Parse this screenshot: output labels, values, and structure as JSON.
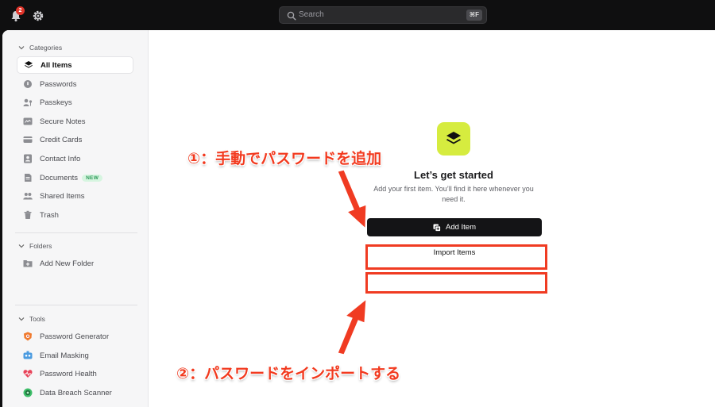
{
  "topbar": {
    "notification_count": "2",
    "search": {
      "placeholder": "Search",
      "shortcut": "⌘F"
    }
  },
  "sidebar": {
    "categories_label": "Categories",
    "categories": [
      {
        "label": "All Items",
        "icon": "layers-icon",
        "active": true
      },
      {
        "label": "Passwords",
        "icon": "key-icon"
      },
      {
        "label": "Passkeys",
        "icon": "passkey-icon"
      },
      {
        "label": "Secure Notes",
        "icon": "note-icon"
      },
      {
        "label": "Credit Cards",
        "icon": "credit-card-icon"
      },
      {
        "label": "Contact Info",
        "icon": "contact-icon"
      },
      {
        "label": "Documents",
        "icon": "document-icon",
        "badge": "NEW"
      },
      {
        "label": "Shared Items",
        "icon": "shared-icon"
      },
      {
        "label": "Trash",
        "icon": "trash-icon"
      }
    ],
    "folders_label": "Folders",
    "folders": [
      {
        "label": "Add New Folder",
        "icon": "add-folder-icon"
      }
    ],
    "tools_label": "Tools",
    "tools": [
      {
        "label": "Password Generator",
        "icon": "password-generator-icon"
      },
      {
        "label": "Email Masking",
        "icon": "email-masking-icon"
      },
      {
        "label": "Password Health",
        "icon": "password-health-icon"
      },
      {
        "label": "Data Breach Scanner",
        "icon": "breach-scanner-icon"
      }
    ]
  },
  "empty_state": {
    "title": "Let’s get started",
    "subtitle": "Add your first item. You’ll find it here whenever you need it.",
    "add_button": "Add Item",
    "import_button": "Import Items"
  },
  "annotations": {
    "step1": "①：手動でパスワードを追加",
    "step2": "②：パスワードをインポートする"
  },
  "colors": {
    "accent": "#d6ec3f",
    "annotation": "#f03b22",
    "badge": "#e0352b",
    "new_badge_bg": "#d6f5e0",
    "new_badge_text": "#2f9a5a"
  }
}
